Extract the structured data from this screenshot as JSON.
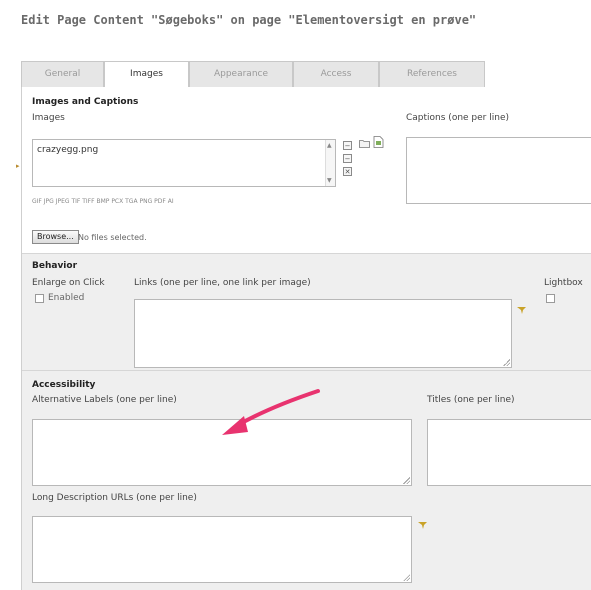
{
  "page": {
    "title": "Edit Page Content \"Søgeboks\" on page \"Elementoversigt en prøve\""
  },
  "tabs": [
    {
      "label": "General",
      "active": false
    },
    {
      "label": "Images",
      "active": true
    },
    {
      "label": "Appearance",
      "active": false
    },
    {
      "label": "Access",
      "active": false
    },
    {
      "label": "References",
      "active": false
    }
  ],
  "images_section": {
    "heading": "Images and Captions",
    "images_label": "Images",
    "images_value": "crazyegg.png",
    "captions_label": "Captions (one per line)",
    "allowed_types": "GIF JPG JPEG TIF TIFF BMP PCX TGA PNG PDF AI",
    "browse_label": "Browse...",
    "file_status": "No files selected."
  },
  "behavior_section": {
    "heading": "Behavior",
    "enlarge_label": "Enlarge on Click",
    "enabled_label": "Enabled",
    "links_label": "Links (one per line, one link per image)",
    "lightbox_label": "Lightbox"
  },
  "accessibility_section": {
    "heading": "Accessibility",
    "alt_label": "Alternative Labels (one per line)",
    "titles_label": "Titles (one per line)",
    "longdesc_label": "Long Description URLs (one per line)"
  },
  "colors": {
    "annotation_arrow": "#e8336f",
    "panel_grey": "#efefef"
  },
  "icons": [
    "move-up-icon",
    "move-down-icon",
    "remove-icon",
    "folder-icon",
    "file-icon",
    "wizard-icon"
  ]
}
